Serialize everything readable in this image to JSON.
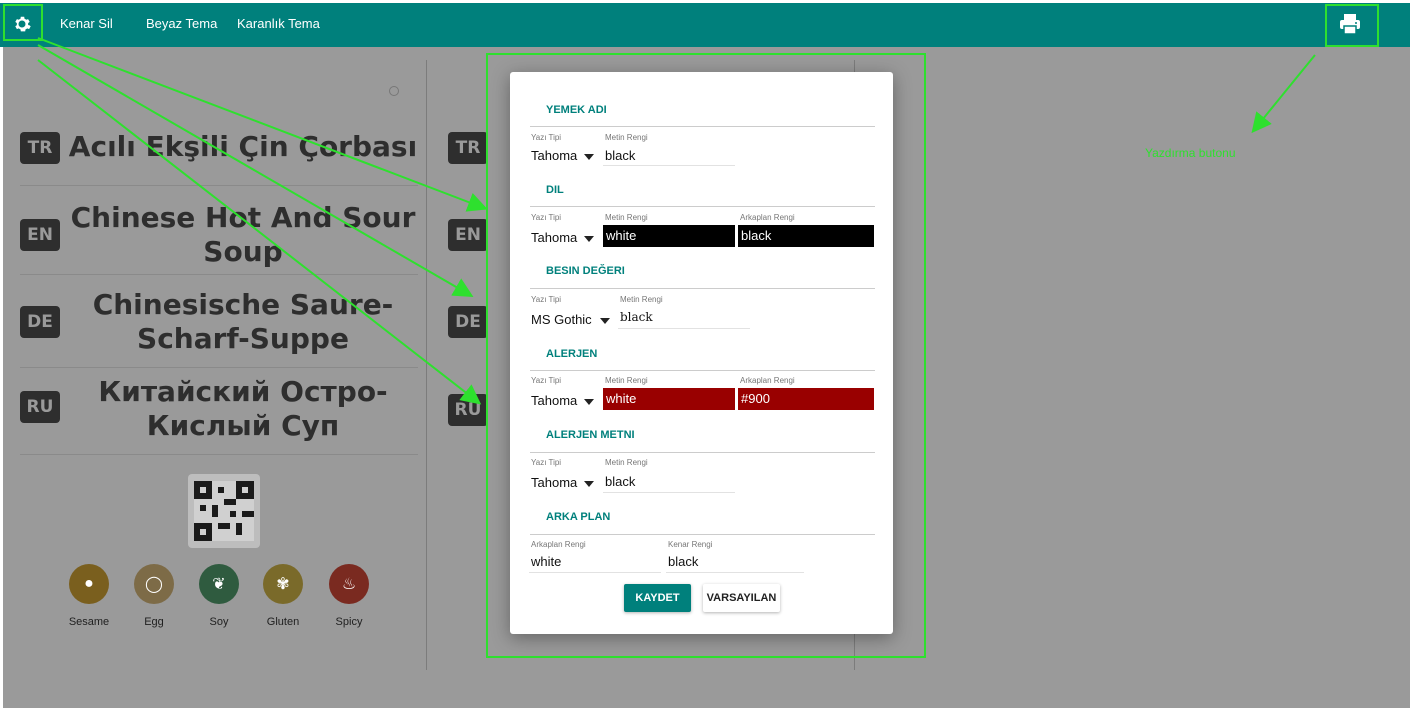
{
  "toolbar": {
    "links": [
      "Kenar Sil",
      "Beyaz Tema",
      "Karanlık Tema"
    ],
    "settings_icon": "gear-icon",
    "print_icon": "printer-icon"
  },
  "menu": {
    "rows": [
      {
        "code": "TR",
        "text": "Acılı Ekşili Çin Çorbası"
      },
      {
        "code": "EN",
        "text": "Chinese Hot And Sour Soup"
      },
      {
        "code": "DE",
        "text": "Chinesische Saure-Scharf-Suppe"
      },
      {
        "code": "RU",
        "text": "Китайский Остро-Кислый Суп"
      }
    ],
    "right_codes": [
      "TR",
      "EN",
      "DE",
      "RU"
    ],
    "allergens": [
      {
        "label": "Sesame",
        "icon": "sesame-icon",
        "color": "#7a5f1e"
      },
      {
        "label": "Egg",
        "icon": "egg-icon",
        "color": "#7d6b47"
      },
      {
        "label": "Soy",
        "icon": "soy-icon",
        "color": "#2f5b3f"
      },
      {
        "label": "Gluten",
        "icon": "gluten-icon",
        "color": "#7a6a2a"
      },
      {
        "label": "Spicy",
        "icon": "chili-icon",
        "color": "#7a2a20"
      }
    ]
  },
  "modal": {
    "sections": {
      "yemek_adi": {
        "title": "YEMEK ADI",
        "font_label": "Yazı Tipi",
        "font": "Tahoma",
        "color_label": "Metin Rengi",
        "color": "black"
      },
      "dil": {
        "title": "DIL",
        "font_label": "Yazı Tipi",
        "font": "Tahoma",
        "color_label": "Metin Rengi",
        "color": "white",
        "bg_label": "Arkaplan Rengi",
        "bg": "black"
      },
      "besin": {
        "title": "BESIN DEĞERI",
        "font_label": "Yazı Tipi",
        "font": "MS Gothic",
        "color_label": "Metin Rengi",
        "color": "black"
      },
      "alerjen": {
        "title": "ALERJEN",
        "font_label": "Yazı Tipi",
        "font": "Tahoma",
        "color_label": "Metin Rengi",
        "color": "white",
        "bg_label": "Arkaplan Rengi",
        "bg": "#900"
      },
      "alerjen_metni": {
        "title": "ALERJEN METNI",
        "font_label": "Yazı Tipi",
        "font": "Tahoma",
        "color_label": "Metin Rengi",
        "color": "black"
      },
      "arka_plan": {
        "title": "ARKA PLAN",
        "bg_label": "Arkaplan Rengi",
        "bg": "white",
        "border_label": "Kenar Rengi",
        "border": "black"
      }
    },
    "save_label": "KAYDET",
    "default_label": "VARSAYILAN"
  },
  "annotation": {
    "print_button_label": "Yazdırma butonu"
  },
  "colors": {
    "accent": "#00807c",
    "annotation": "#2ee02e",
    "allergen_bg": "#990000"
  }
}
